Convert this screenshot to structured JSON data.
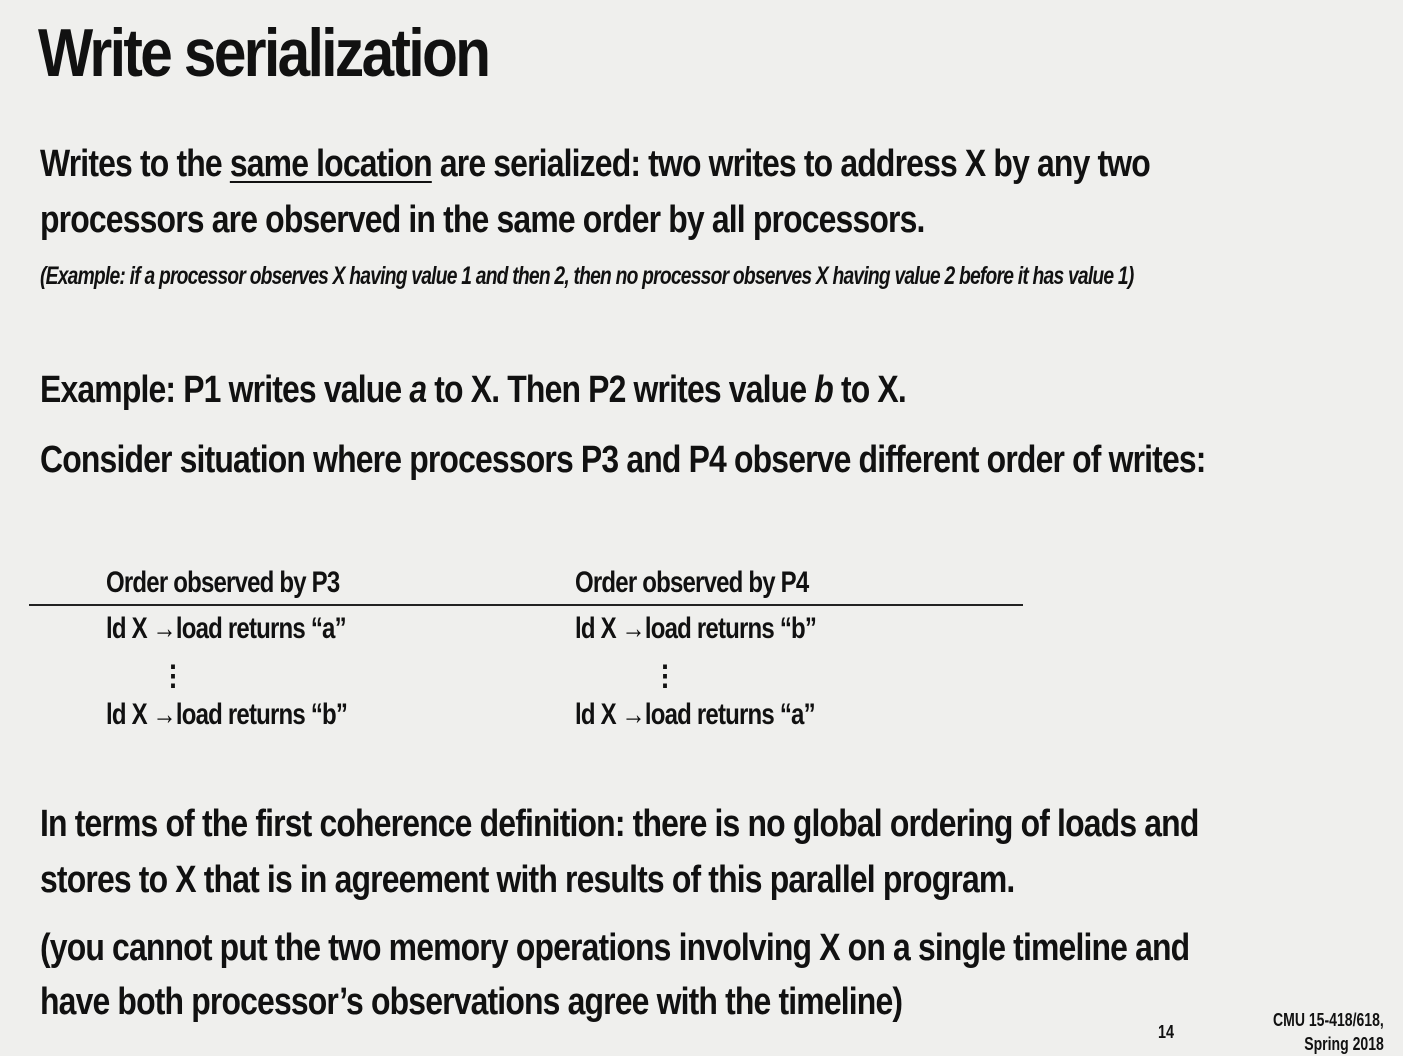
{
  "title": "Write serialization",
  "intro": {
    "pre": "Writes to the ",
    "underlined": "same location",
    "post": " are serialized: two writes to address X by any two",
    "line2": "processors are observed in the same order by all processors."
  },
  "example_note": "(Example: if a processor observes X having value 1 and then 2, then no processor observes X having value 2 before it has value 1)",
  "example_line": {
    "part1": "Example: P1 writes value ",
    "var_a": "a",
    "part2": " to X.  Then P2 writes value ",
    "var_b": "b",
    "part3": " to X."
  },
  "consider_line": "Consider situation where processors P3 and P4 observe different order of writes:",
  "table": {
    "p3": {
      "header": "Order observed by P3",
      "row1": "ld X →load returns “a”",
      "row2": "ld X →load returns “b”"
    },
    "p4": {
      "header": "Order observed by P4",
      "row1": "ld X →load returns “b”",
      "row2": "ld X →load returns “a”"
    },
    "ellipsis": "⋮"
  },
  "conclusion": {
    "line1": "In terms of the first coherence definition: there is no global ordering of loads and",
    "line2": "stores to X that is in agreement with results of this parallel program."
  },
  "parenthetical": {
    "line1": "(you cannot put the two memory operations involving X on a single timeline and",
    "line2": "have both processor’s observations agree with the timeline)"
  },
  "footer": {
    "page_number": "14",
    "course_line1": "CMU 15-418/618,",
    "course_line2": "Spring 2018"
  }
}
